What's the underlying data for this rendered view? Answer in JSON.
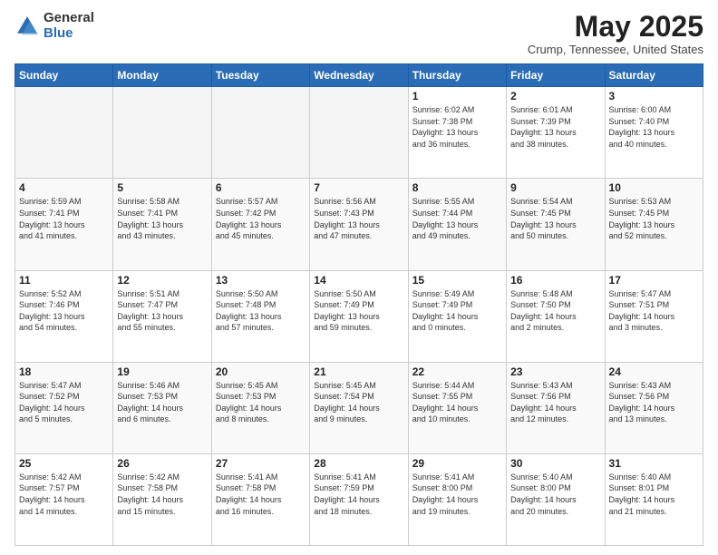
{
  "logo": {
    "general": "General",
    "blue": "Blue"
  },
  "title": "May 2025",
  "location": "Crump, Tennessee, United States",
  "days_of_week": [
    "Sunday",
    "Monday",
    "Tuesday",
    "Wednesday",
    "Thursday",
    "Friday",
    "Saturday"
  ],
  "weeks": [
    [
      {
        "day": "",
        "content": ""
      },
      {
        "day": "",
        "content": ""
      },
      {
        "day": "",
        "content": ""
      },
      {
        "day": "",
        "content": ""
      },
      {
        "day": "1",
        "content": "Sunrise: 6:02 AM\nSunset: 7:38 PM\nDaylight: 13 hours\nand 36 minutes."
      },
      {
        "day": "2",
        "content": "Sunrise: 6:01 AM\nSunset: 7:39 PM\nDaylight: 13 hours\nand 38 minutes."
      },
      {
        "day": "3",
        "content": "Sunrise: 6:00 AM\nSunset: 7:40 PM\nDaylight: 13 hours\nand 40 minutes."
      }
    ],
    [
      {
        "day": "4",
        "content": "Sunrise: 5:59 AM\nSunset: 7:41 PM\nDaylight: 13 hours\nand 41 minutes."
      },
      {
        "day": "5",
        "content": "Sunrise: 5:58 AM\nSunset: 7:41 PM\nDaylight: 13 hours\nand 43 minutes."
      },
      {
        "day": "6",
        "content": "Sunrise: 5:57 AM\nSunset: 7:42 PM\nDaylight: 13 hours\nand 45 minutes."
      },
      {
        "day": "7",
        "content": "Sunrise: 5:56 AM\nSunset: 7:43 PM\nDaylight: 13 hours\nand 47 minutes."
      },
      {
        "day": "8",
        "content": "Sunrise: 5:55 AM\nSunset: 7:44 PM\nDaylight: 13 hours\nand 49 minutes."
      },
      {
        "day": "9",
        "content": "Sunrise: 5:54 AM\nSunset: 7:45 PM\nDaylight: 13 hours\nand 50 minutes."
      },
      {
        "day": "10",
        "content": "Sunrise: 5:53 AM\nSunset: 7:45 PM\nDaylight: 13 hours\nand 52 minutes."
      }
    ],
    [
      {
        "day": "11",
        "content": "Sunrise: 5:52 AM\nSunset: 7:46 PM\nDaylight: 13 hours\nand 54 minutes."
      },
      {
        "day": "12",
        "content": "Sunrise: 5:51 AM\nSunset: 7:47 PM\nDaylight: 13 hours\nand 55 minutes."
      },
      {
        "day": "13",
        "content": "Sunrise: 5:50 AM\nSunset: 7:48 PM\nDaylight: 13 hours\nand 57 minutes."
      },
      {
        "day": "14",
        "content": "Sunrise: 5:50 AM\nSunset: 7:49 PM\nDaylight: 13 hours\nand 59 minutes."
      },
      {
        "day": "15",
        "content": "Sunrise: 5:49 AM\nSunset: 7:49 PM\nDaylight: 14 hours\nand 0 minutes."
      },
      {
        "day": "16",
        "content": "Sunrise: 5:48 AM\nSunset: 7:50 PM\nDaylight: 14 hours\nand 2 minutes."
      },
      {
        "day": "17",
        "content": "Sunrise: 5:47 AM\nSunset: 7:51 PM\nDaylight: 14 hours\nand 3 minutes."
      }
    ],
    [
      {
        "day": "18",
        "content": "Sunrise: 5:47 AM\nSunset: 7:52 PM\nDaylight: 14 hours\nand 5 minutes."
      },
      {
        "day": "19",
        "content": "Sunrise: 5:46 AM\nSunset: 7:53 PM\nDaylight: 14 hours\nand 6 minutes."
      },
      {
        "day": "20",
        "content": "Sunrise: 5:45 AM\nSunset: 7:53 PM\nDaylight: 14 hours\nand 8 minutes."
      },
      {
        "day": "21",
        "content": "Sunrise: 5:45 AM\nSunset: 7:54 PM\nDaylight: 14 hours\nand 9 minutes."
      },
      {
        "day": "22",
        "content": "Sunrise: 5:44 AM\nSunset: 7:55 PM\nDaylight: 14 hours\nand 10 minutes."
      },
      {
        "day": "23",
        "content": "Sunrise: 5:43 AM\nSunset: 7:56 PM\nDaylight: 14 hours\nand 12 minutes."
      },
      {
        "day": "24",
        "content": "Sunrise: 5:43 AM\nSunset: 7:56 PM\nDaylight: 14 hours\nand 13 minutes."
      }
    ],
    [
      {
        "day": "25",
        "content": "Sunrise: 5:42 AM\nSunset: 7:57 PM\nDaylight: 14 hours\nand 14 minutes."
      },
      {
        "day": "26",
        "content": "Sunrise: 5:42 AM\nSunset: 7:58 PM\nDaylight: 14 hours\nand 15 minutes."
      },
      {
        "day": "27",
        "content": "Sunrise: 5:41 AM\nSunset: 7:58 PM\nDaylight: 14 hours\nand 16 minutes."
      },
      {
        "day": "28",
        "content": "Sunrise: 5:41 AM\nSunset: 7:59 PM\nDaylight: 14 hours\nand 18 minutes."
      },
      {
        "day": "29",
        "content": "Sunrise: 5:41 AM\nSunset: 8:00 PM\nDaylight: 14 hours\nand 19 minutes."
      },
      {
        "day": "30",
        "content": "Sunrise: 5:40 AM\nSunset: 8:00 PM\nDaylight: 14 hours\nand 20 minutes."
      },
      {
        "day": "31",
        "content": "Sunrise: 5:40 AM\nSunset: 8:01 PM\nDaylight: 14 hours\nand 21 minutes."
      }
    ]
  ]
}
